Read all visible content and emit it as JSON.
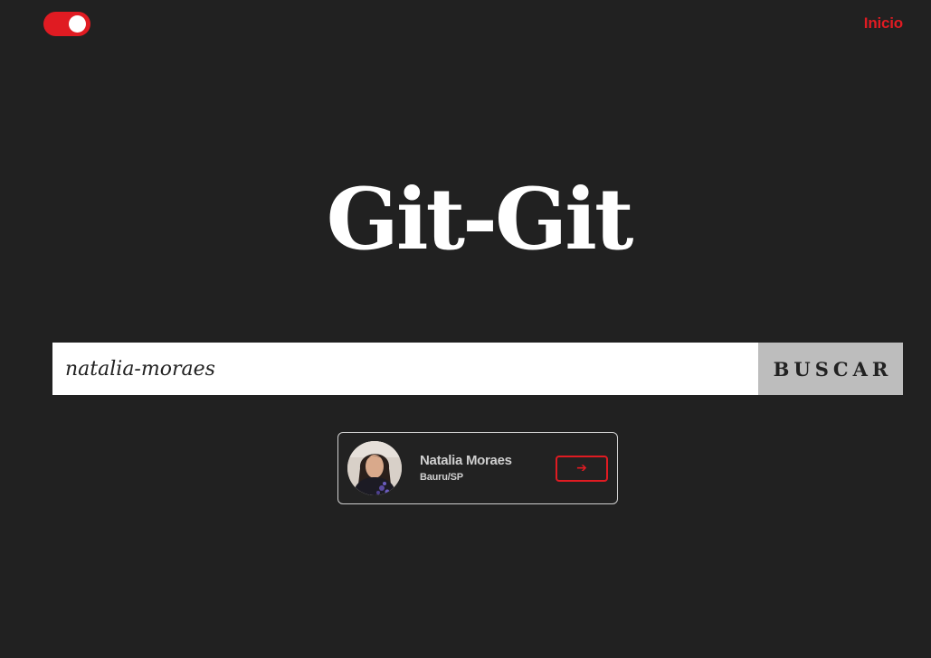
{
  "header": {
    "theme_toggle_state": "on",
    "nav_link_label": "Inicio"
  },
  "main": {
    "title": "Git-Git"
  },
  "search": {
    "value": "natalia-moraes",
    "button_label": "BUSCAR"
  },
  "result_card": {
    "name": "Natalia Moraes",
    "location": "Bauru/SP",
    "action_icon": "arrow-right-icon",
    "action_glyph": "➔"
  },
  "colors": {
    "background": "#212121",
    "accent": "#e01b22",
    "text_light": "#ffffff",
    "card_text": "#cfcfcf",
    "button_bg": "#bdbdbd"
  }
}
